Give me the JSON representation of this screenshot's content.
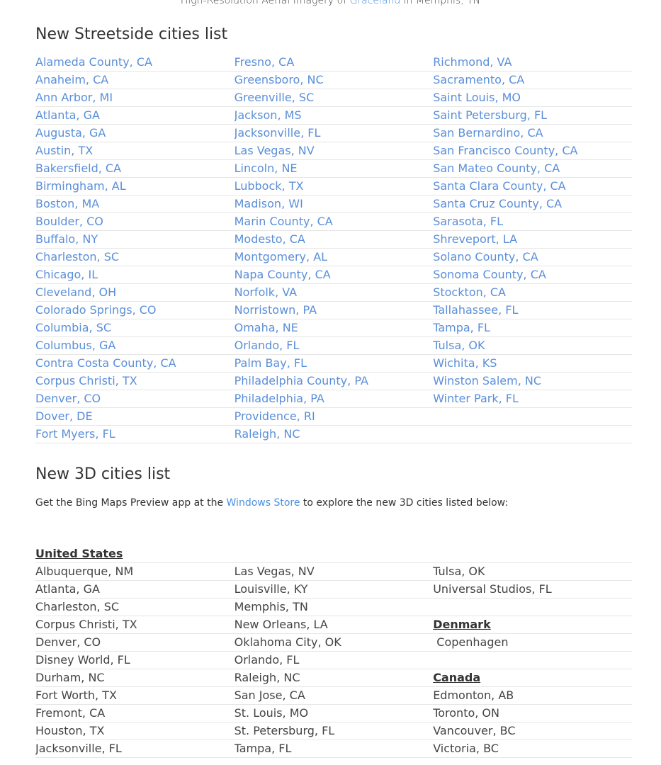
{
  "top_caption": {
    "prefix": "High-Resolution Aerial Imagery of ",
    "link": "Graceland",
    "suffix": " in Memphis, TN"
  },
  "streetside": {
    "title": "New Streetside cities list",
    "columns": [
      [
        "Alameda County, CA",
        "Anaheim, CA",
        "Ann Arbor, MI",
        "Atlanta, GA",
        "Augusta, GA",
        "Austin, TX",
        "Bakersfield, CA",
        "Birmingham, AL",
        "Boston, MA",
        "Boulder, CO",
        "Buffalo, NY",
        "Charleston, SC",
        "Chicago, IL",
        "Cleveland, OH",
        "Colorado Springs, CO",
        "Columbia, SC",
        "Columbus, GA",
        "Contra Costa County, CA",
        "Corpus Christi, TX",
        "Denver, CO",
        "Dover, DE",
        "Fort Myers, FL"
      ],
      [
        "Fresno, CA",
        "Greensboro, NC",
        "Greenville, SC",
        "Jackson, MS",
        "Jacksonville, FL",
        "Las Vegas, NV",
        "Lincoln, NE",
        "Lubbock, TX",
        "Madison, WI",
        "Marin County, CA",
        "Modesto, CA",
        "Montgomery, AL",
        "Napa County, CA",
        "Norfolk, VA",
        "Norristown, PA",
        "Omaha, NE",
        "Orlando, FL",
        "Palm Bay, FL",
        "Philadelphia County, PA",
        "Philadelphia, PA",
        "Providence, RI",
        "Raleigh, NC"
      ],
      [
        "Richmond, VA",
        "Sacramento, CA",
        "Saint Louis, MO",
        "Saint Petersburg, FL",
        "San Bernardino, CA",
        "San Francisco County, CA",
        "San Mateo County, CA",
        "Santa Clara County, CA",
        "Santa Cruz County, CA",
        "Sarasota, FL",
        "Shreveport, LA",
        "Solano County, CA",
        "Sonoma County, CA",
        "Stockton, CA",
        "Tallahassee, FL",
        "Tampa, FL",
        "Tulsa, OK",
        "Wichita, KS",
        "Winston Salem, NC",
        "Winter Park, FL",
        "",
        ""
      ]
    ]
  },
  "cities3d": {
    "title": "New 3D cities list",
    "intro_prefix": "Get the Bing Maps Preview app at the ",
    "intro_link": "Windows Store",
    "intro_suffix": " to explore the new 3D cities listed below:",
    "rows": [
      [
        {
          "t": "United States",
          "k": "heading"
        },
        {
          "t": "",
          "k": "plain"
        },
        {
          "t": "",
          "k": "plain"
        }
      ],
      [
        {
          "t": "Albuquerque, NM",
          "k": "plain"
        },
        {
          "t": "Las Vegas, NV",
          "k": "plain"
        },
        {
          "t": "Tulsa, OK",
          "k": "plain"
        }
      ],
      [
        {
          "t": "Atlanta, GA",
          "k": "plain"
        },
        {
          "t": "Louisville, KY",
          "k": "plain"
        },
        {
          "t": "Universal Studios, FL",
          "k": "plain"
        }
      ],
      [
        {
          "t": "Charleston, SC",
          "k": "plain"
        },
        {
          "t": "Memphis, TN",
          "k": "plain"
        },
        {
          "t": "",
          "k": "plain"
        }
      ],
      [
        {
          "t": "Corpus Christi, TX",
          "k": "plain"
        },
        {
          "t": "New Orleans, LA",
          "k": "plain"
        },
        {
          "t": "Denmark",
          "k": "heading"
        }
      ],
      [
        {
          "t": "Denver, CO",
          "k": "plain"
        },
        {
          "t": "Oklahoma City, OK",
          "k": "plain"
        },
        {
          "t": " Copenhagen",
          "k": "plain"
        }
      ],
      [
        {
          "t": "Disney World, FL",
          "k": "plain"
        },
        {
          "t": "Orlando, FL",
          "k": "plain"
        },
        {
          "t": "",
          "k": "plain"
        }
      ],
      [
        {
          "t": "Durham, NC",
          "k": "plain"
        },
        {
          "t": "Raleigh, NC",
          "k": "plain"
        },
        {
          "t": "Canada",
          "k": "heading"
        }
      ],
      [
        {
          "t": "Fort Worth, TX",
          "k": "plain"
        },
        {
          "t": "San Jose, CA",
          "k": "plain"
        },
        {
          "t": "Edmonton, AB",
          "k": "plain"
        }
      ],
      [
        {
          "t": "Fremont, CA",
          "k": "plain"
        },
        {
          "t": "St. Louis, MO",
          "k": "plain"
        },
        {
          "t": "Toronto, ON",
          "k": "plain"
        }
      ],
      [
        {
          "t": "Houston, TX",
          "k": "plain"
        },
        {
          "t": "St. Petersburg, FL",
          "k": "plain"
        },
        {
          "t": "Vancouver, BC",
          "k": "plain"
        }
      ],
      [
        {
          "t": "Jacksonville, FL",
          "k": "plain"
        },
        {
          "t": "Tampa, FL",
          "k": "plain"
        },
        {
          "t": "Victoria, BC",
          "k": "plain"
        }
      ]
    ]
  }
}
